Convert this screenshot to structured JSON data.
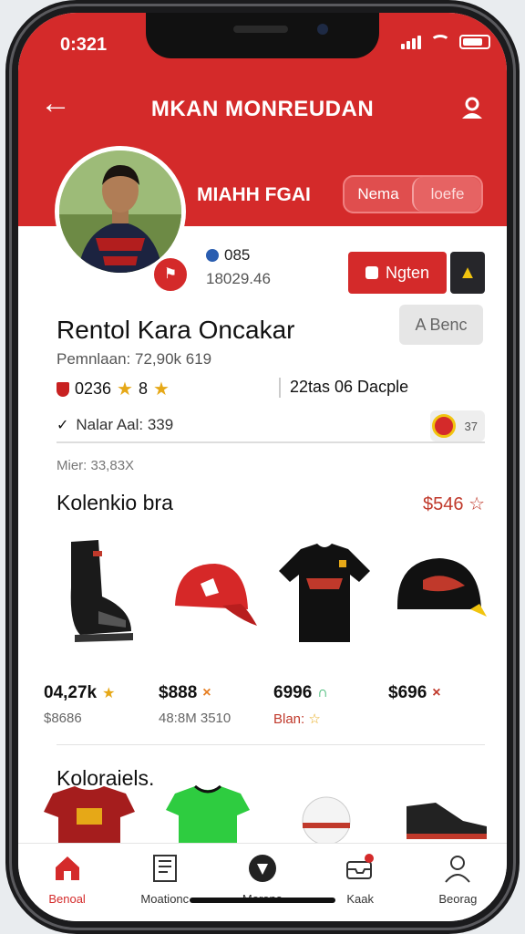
{
  "status": {
    "time": "0:321"
  },
  "header": {
    "title": "MKAN MONREUDAN",
    "name": "MIAHH FGAI",
    "toggle": [
      "Nema",
      "loefe"
    ]
  },
  "profile": {
    "meta_line1": "085",
    "meta_line2": "18029.46",
    "primary_button": "Ngten",
    "page_title": "Rentol Kara Oncakar",
    "grey_button": "A Benc",
    "sub_line": "Pemnlaan: 72,90k 619",
    "stat_left": "0236",
    "stat_left_num": "8",
    "stat_right": "22tas 06 Dacple",
    "field_label": "Nalar Aal: 339",
    "chip_text": "37",
    "meta3": "Mier: 33,83X"
  },
  "collection": {
    "title": "Kolenkio bra",
    "price": "$546",
    "items": [
      {
        "price": "04,27k",
        "sub": "$8686",
        "icon": "shoe-icon"
      },
      {
        "price": "$888",
        "sub": "48:8M 3510",
        "icon": "cap-icon"
      },
      {
        "price": "6996",
        "sub": "Blan:",
        "icon": "shirt-icon"
      },
      {
        "price": "$696",
        "sub": "",
        "icon": "helmet-cap-icon"
      }
    ]
  },
  "section2": {
    "title": "Koloraiels."
  },
  "tabs": [
    {
      "label": "Benoal",
      "icon": "home-icon"
    },
    {
      "label": "Moationc",
      "icon": "clipboard-icon"
    },
    {
      "label": "Merona",
      "icon": "chat-icon"
    },
    {
      "label": "Kaak",
      "icon": "inbox-icon"
    },
    {
      "label": "Beorag",
      "icon": "profile-icon"
    }
  ],
  "colors": {
    "accent": "#d42a2a",
    "star": "#e6a817"
  }
}
